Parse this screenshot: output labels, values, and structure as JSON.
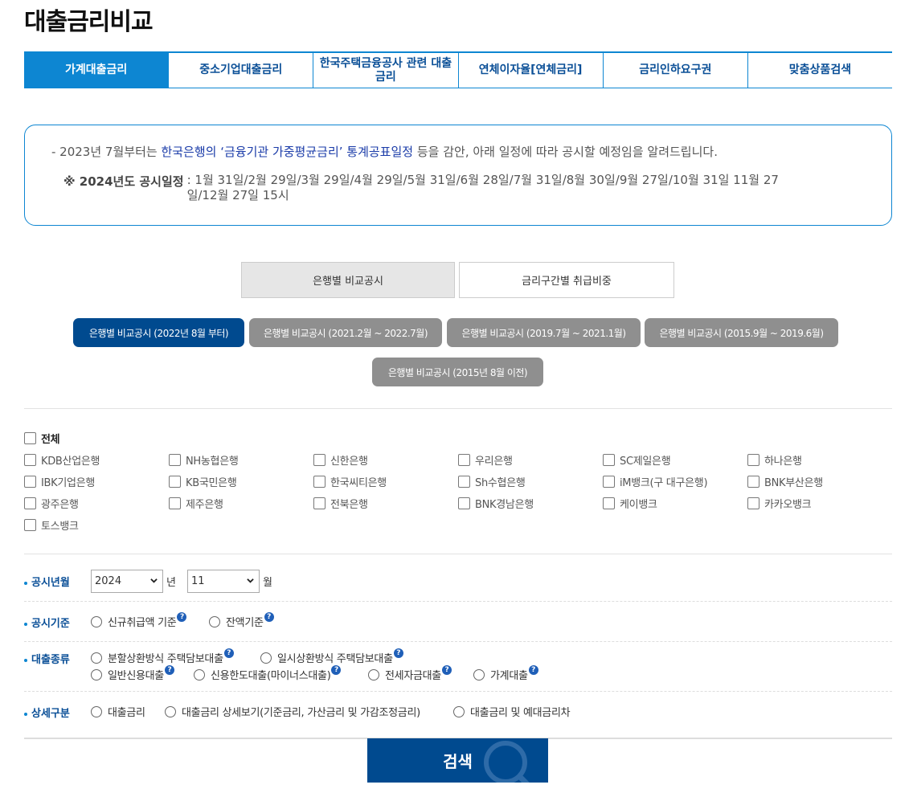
{
  "page_title": "대출금리비교",
  "tabs": [
    {
      "label": "가계대출금리",
      "active": true
    },
    {
      "label": "중소기업대출금리",
      "active": false
    },
    {
      "label": "한국주택금융공사 관련 대출금리",
      "active": false
    },
    {
      "label": "연체이자율[연체금리]",
      "active": false
    },
    {
      "label": "금리인하요구권",
      "active": false
    },
    {
      "label": "맞춤상품검색",
      "active": false
    }
  ],
  "notice": {
    "line1_prefix": "- 2023년 7월부터는 ",
    "line1_highlight": "한국은행의 ‘금융기관 가중평균금리’ 통계공표일정",
    "line1_suffix": " 등을 감안, 아래 일정에 따라 공시할 예정임을 알려드립니다.",
    "schedule_label": "※ 2024년도 공시일정",
    "schedule_dates": ": 1월 31일/2월 29일/3월 29일/4월 29일/5월 31일/6월 28일/7월 31일/8월 30일/9월 27일/10월 31일 11월 27일/12월 27일 15시"
  },
  "view_toggle": {
    "selected": "은행별 비교공시",
    "other": "금리구간별 취급비중"
  },
  "periods": [
    {
      "label": "은행별 비교공시 (2022년 8월 부터)",
      "active": true
    },
    {
      "label": "은행별 비교공시 (2021.2월 ~ 2022.7월)",
      "active": false
    },
    {
      "label": "은행별 비교공시 (2019.7월 ~ 2021.1월)",
      "active": false
    },
    {
      "label": "은행별 비교공시 (2015.9월 ~ 2019.6월)",
      "active": false
    },
    {
      "label": "은행별 비교공시 (2015년 8월 이전)",
      "active": false
    }
  ],
  "banks": {
    "all_label": "전체",
    "items": [
      "KDB산업은행",
      "NH농협은행",
      "신한은행",
      "우리은행",
      "SC제일은행",
      "하나은행",
      "IBK기업은행",
      "KB국민은행",
      "한국씨티은행",
      "Sh수협은행",
      "iM뱅크(구 대구은행)",
      "BNK부산은행",
      "광주은행",
      "제주은행",
      "전북은행",
      "BNK경남은행",
      "케이뱅크",
      "카카오뱅크",
      "토스뱅크"
    ]
  },
  "form": {
    "year_month": {
      "label": "공시년월",
      "year": "2024",
      "year_unit": "년",
      "month": "11",
      "month_unit": "월"
    },
    "basis": {
      "label": "공시기준",
      "options": [
        "신규취급액 기준",
        "잔액기준"
      ]
    },
    "loan_type": {
      "label": "대출종류",
      "options": [
        "분할상환방식 주택담보대출",
        "일시상환방식 주택담보대출",
        "일반신용대출",
        "신용한도대출(마이너스대출)",
        "전세자금대출",
        "가계대출"
      ]
    },
    "detail": {
      "label": "상세구분",
      "options": [
        "대출금리",
        "대출금리 상세보기(기준금리, 가산금리 및 가감조정금리)",
        "대출금리 및 예대금리차"
      ]
    }
  },
  "search_label": "검색",
  "colors": {
    "primary": "#0d86d2",
    "navy": "#004a8f",
    "pill_gray": "#8f8f8f"
  }
}
